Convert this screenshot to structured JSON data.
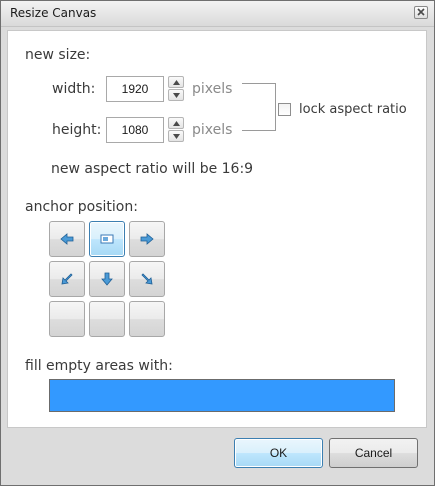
{
  "window": {
    "title": "Resize Canvas"
  },
  "new_size": {
    "heading": "new size:",
    "width_label": "width:",
    "width_value": "1920",
    "height_label": "height:",
    "height_value": "1080",
    "unit": "pixels",
    "lock_label": "lock aspect ratio",
    "lock_checked": false,
    "aspect_text": "new aspect ratio will be 16:9"
  },
  "anchor": {
    "heading": "anchor position:",
    "selected": "top-center",
    "icons": [
      "arrow-left-icon",
      "image-icon",
      "arrow-right-icon",
      "arrow-down-left-icon",
      "arrow-down-icon",
      "arrow-down-right-icon",
      "",
      "",
      ""
    ]
  },
  "fill": {
    "heading": "fill empty areas with:",
    "color": "#3399ff"
  },
  "buttons": {
    "ok": "OK",
    "cancel": "Cancel"
  }
}
